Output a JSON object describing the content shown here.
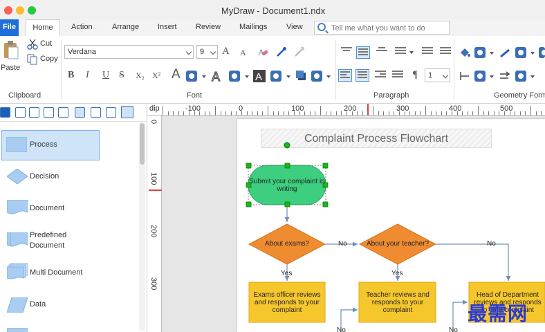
{
  "window": {
    "title": "MyDraw - Document1.ndx"
  },
  "tabs": [
    "File",
    "Home",
    "Action",
    "Arrange",
    "Insert",
    "Review",
    "Mailings",
    "View"
  ],
  "search": {
    "placeholder": "Tell me what you want to do"
  },
  "ribbon": {
    "clipboard": {
      "paste": "Paste",
      "cut": "Cut",
      "copy": "Copy",
      "label": "Clipboard"
    },
    "font": {
      "family": "Verdana",
      "size": "9",
      "label": "Font",
      "bold": "B",
      "italic": "I",
      "underline": "U",
      "strike": "S",
      "sub": "X₂",
      "sup": "X²",
      "grow": "A",
      "shrink": "A",
      "color_a": "A"
    },
    "paragraph": {
      "label": "Paragraph",
      "pilcrow": "¶",
      "spacing": "1"
    },
    "geometry": {
      "label": "Geometry Form"
    }
  },
  "shapes": [
    {
      "label": "Process"
    },
    {
      "label": "Decision"
    },
    {
      "label": "Document"
    },
    {
      "label": "Predefined Document"
    },
    {
      "label": "Multi Document"
    },
    {
      "label": "Data"
    }
  ],
  "ruler": {
    "unit": "dip",
    "top": [
      "-100",
      "0",
      "100",
      "200",
      "300",
      "400",
      "500"
    ],
    "left": [
      "0",
      "100",
      "200",
      "300"
    ]
  },
  "flowchart": {
    "title": "Complaint Process Flowchart",
    "start": "Submit your complaint in writing",
    "decision1": "About exams?",
    "decision2": "About your teacher?",
    "box1": "Exams officer reviews and responds to your complaint",
    "box2": "Teacher reviews and responds to your complaint",
    "box3": "Head of Department reviews and responds to your complaint",
    "yes1": "Yes",
    "yes2": "Yes",
    "no1": "No",
    "no2": "No",
    "no3": "No",
    "no4": "No"
  },
  "colors": {
    "accent": "#1e6fd9",
    "start_fill": "#3dce80",
    "decision_fill": "#ef8c32",
    "process_fill": "#f6c72d",
    "connector": "#6d8fb8",
    "selection": "#19b819"
  },
  "watermark": "最需网"
}
